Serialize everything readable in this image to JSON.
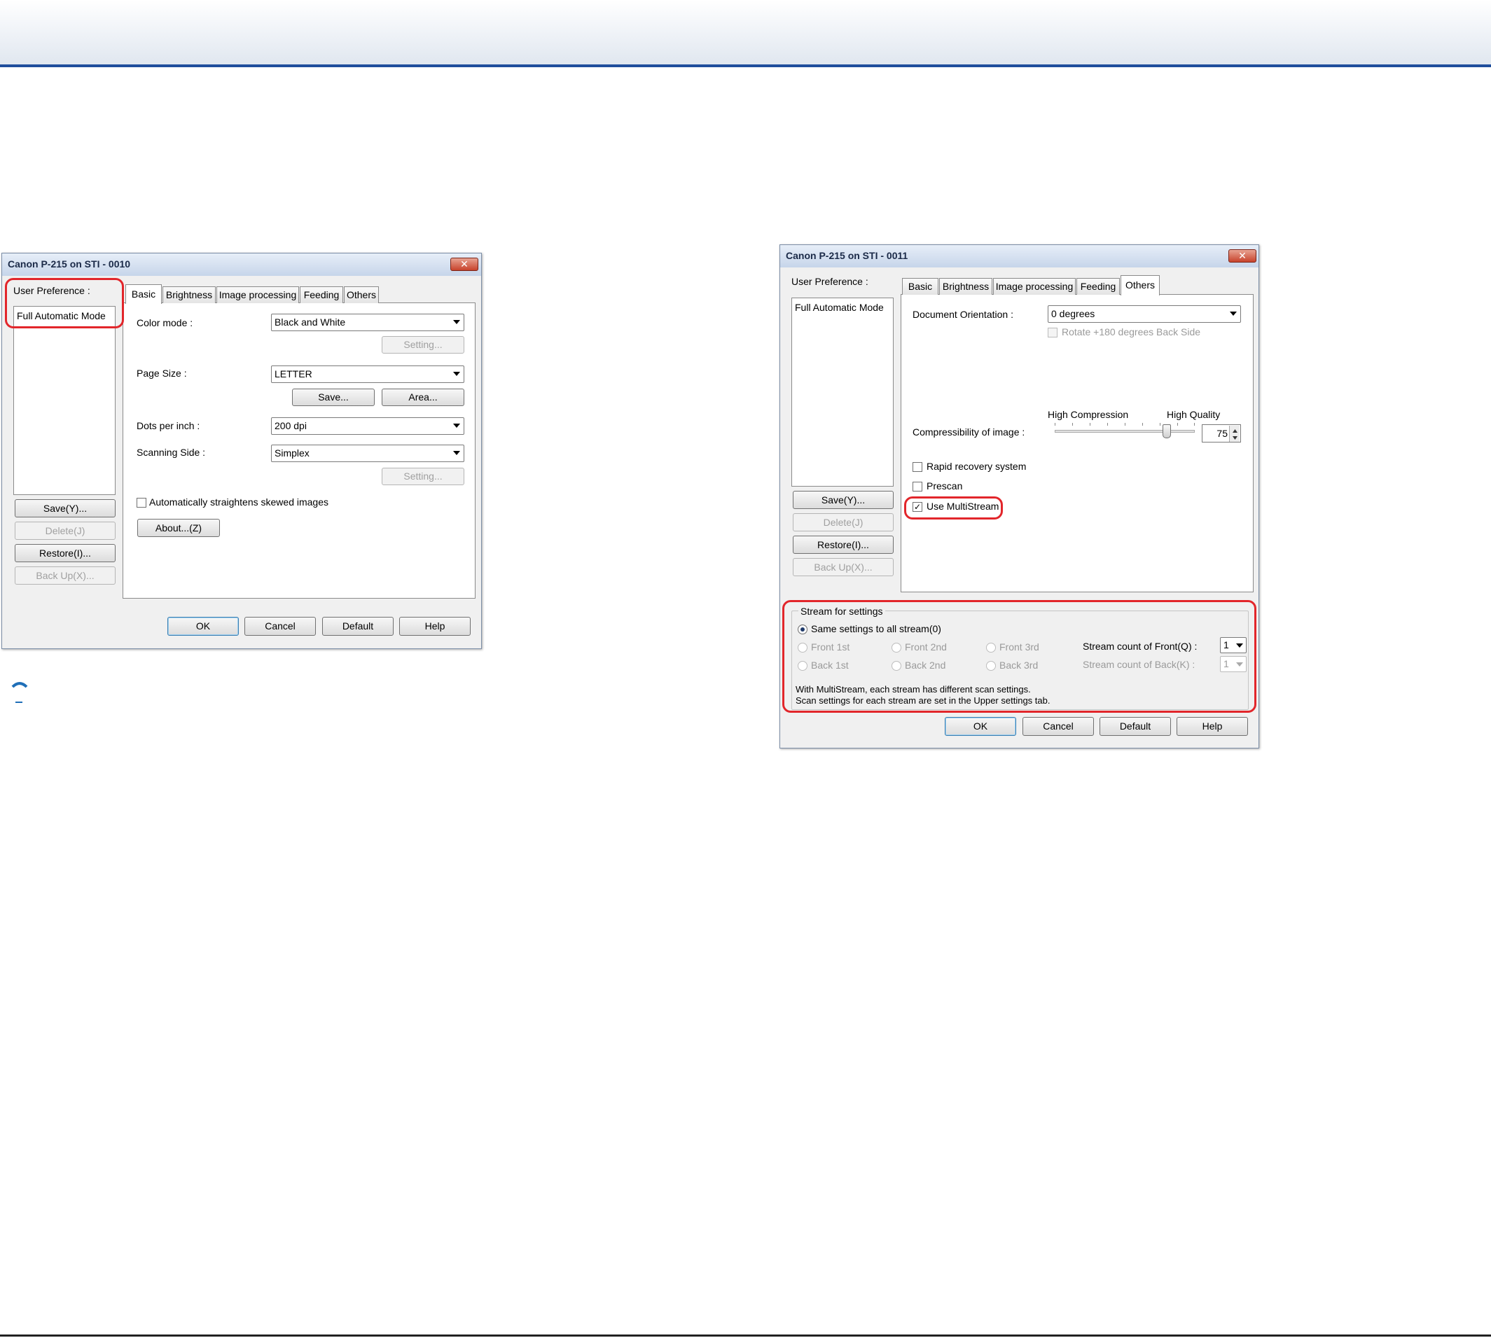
{
  "left_dialog": {
    "title": "Canon P-215 on STI - 0010",
    "close_glyph": "✕",
    "user_preference_label": "User Preference :",
    "preference_items": [
      "Full Automatic Mode"
    ],
    "side_buttons": {
      "save": "Save(Y)...",
      "delete": "Delete(J)",
      "restore": "Restore(I)...",
      "backup": "Back Up(X)..."
    },
    "tabs": [
      "Basic",
      "Brightness",
      "Image processing",
      "Feeding",
      "Others"
    ],
    "active_tab": "Basic",
    "color_mode_label": "Color mode :",
    "color_mode_value": "Black and White",
    "color_setting_button": "Setting...",
    "page_size_label": "Page Size :",
    "page_size_value": "LETTER",
    "save_button": "Save...",
    "area_button": "Area...",
    "dpi_label": "Dots per inch :",
    "dpi_value": "200 dpi",
    "scanning_side_label": "Scanning Side :",
    "scanning_side_value": "Simplex",
    "side_setting_button": "Setting...",
    "straighten_label": "Automatically straightens skewed images",
    "straighten_checked": false,
    "about_button": "About...(Z)",
    "footer": {
      "ok": "OK",
      "cancel": "Cancel",
      "default": "Default",
      "help": "Help"
    }
  },
  "right_dialog": {
    "title": "Canon P-215 on STI - 0011",
    "close_glyph": "✕",
    "user_preference_label": "User Preference :",
    "preference_items": [
      "Full Automatic Mode"
    ],
    "side_buttons": {
      "save": "Save(Y)...",
      "delete": "Delete(J)",
      "restore": "Restore(I)...",
      "backup": "Back Up(X)..."
    },
    "tabs": [
      "Basic",
      "Brightness",
      "Image processing",
      "Feeding",
      "Others"
    ],
    "active_tab": "Others",
    "doc_orientation_label": "Document Orientation :",
    "doc_orientation_value": "0 degrees",
    "rotate_label": "Rotate +180 degrees Back Side",
    "high_compression_label": "High Compression",
    "high_quality_label": "High Quality",
    "compressibility_label": "Compressibility of image :",
    "compressibility_value": "75",
    "compressibility_fraction": 0.8,
    "rapid_recovery_label": "Rapid recovery system",
    "rapid_recovery_checked": false,
    "prescan_label": "Prescan",
    "prescan_checked": false,
    "multistream_label": "Use MultiStream",
    "multistream_checked": true,
    "check_glyph": "✓",
    "stream_group_label": "Stream for settings",
    "radio_same": "Same settings to all stream(0)",
    "radio_front1": "Front 1st",
    "radio_front2": "Front 2nd",
    "radio_front3": "Front 3rd",
    "radio_back1": "Back 1st",
    "radio_back2": "Back 2nd",
    "radio_back3": "Back 3rd",
    "stream_front_label": "Stream count of Front(Q) :",
    "stream_front_value": "1",
    "stream_back_label": "Stream count of Back(K) :",
    "stream_back_value": "1",
    "note_line1": "With MultiStream, each stream has different scan settings.",
    "note_line2": "Scan settings for each stream are set in the Upper settings tab.",
    "footer": {
      "ok": "OK",
      "cancel": "Cancel",
      "default": "Default",
      "help": "Help"
    }
  },
  "colors": {
    "highlight": "#e2262b",
    "header_rule": "#1f4e9c"
  }
}
